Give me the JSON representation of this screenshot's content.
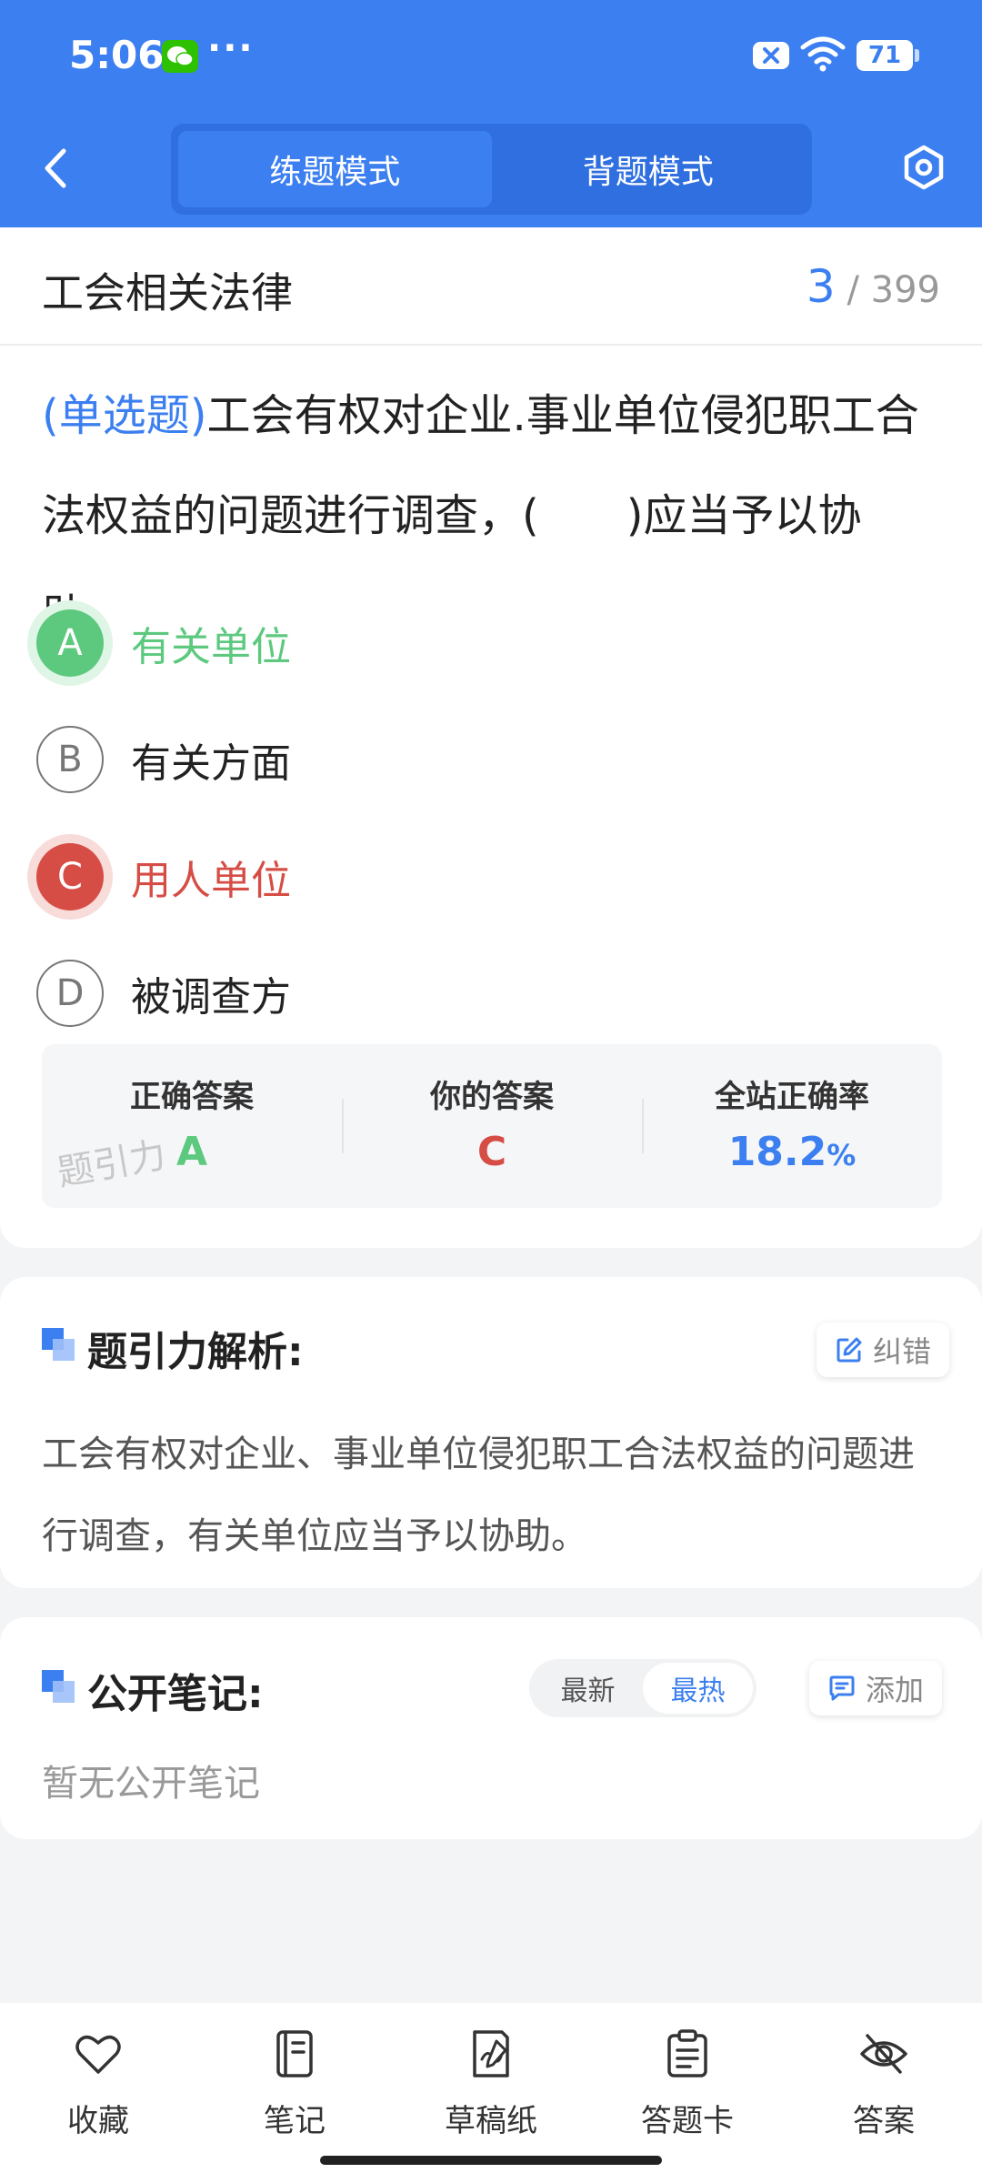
{
  "status_bar": {
    "time": "5:06",
    "more": "···",
    "battery": "71"
  },
  "header": {
    "mode_tabs": [
      {
        "label": "练题模式",
        "active": true
      },
      {
        "label": "背题模式",
        "active": false
      }
    ]
  },
  "question": {
    "subject": "工会相关法律",
    "progress_current": "3",
    "progress_total": "/ 399",
    "type_label": "(单选题)",
    "number": "3",
    "text": "工会有权对企业.事业单位侵犯职工合法权益的问题进行调查，(　　)应当予以协助。",
    "options": [
      {
        "letter": "A",
        "text": "有关单位",
        "state": "correct"
      },
      {
        "letter": "B",
        "text": "有关方面",
        "state": "normal"
      },
      {
        "letter": "C",
        "text": "用人单位",
        "state": "wrong"
      },
      {
        "letter": "D",
        "text": "被调查方",
        "state": "normal"
      }
    ]
  },
  "answer_summary": {
    "correct_label": "正确答案",
    "correct_value": "A",
    "yours_label": "你的答案",
    "yours_value": "C",
    "rate_label": "全站正确率",
    "rate_value": "18.2",
    "rate_unit": "%",
    "watermark": "题引力"
  },
  "analysis": {
    "title": "题引力解析:",
    "report_label": "纠错",
    "text": "工会有权对企业、事业单位侵犯职工合法权益的问题进行调查，有关单位应当予以协助。"
  },
  "notes": {
    "title": "公开笔记:",
    "sort_tabs": [
      {
        "label": "最新",
        "active": false
      },
      {
        "label": "最热",
        "active": true
      }
    ],
    "add_label": "添加",
    "empty_text": "暂无公开笔记"
  },
  "bottom_bar": {
    "items": [
      {
        "label": "收藏",
        "icon": "heart-icon"
      },
      {
        "label": "笔记",
        "icon": "notebook-icon"
      },
      {
        "label": "草稿纸",
        "icon": "draft-paper-icon"
      },
      {
        "label": "答题卡",
        "icon": "answer-card-icon"
      },
      {
        "label": "答案",
        "icon": "eye-off-icon"
      }
    ]
  },
  "colors": {
    "primary": "#3c7ff0",
    "correct": "#5cc97e",
    "wrong": "#d64d45"
  }
}
